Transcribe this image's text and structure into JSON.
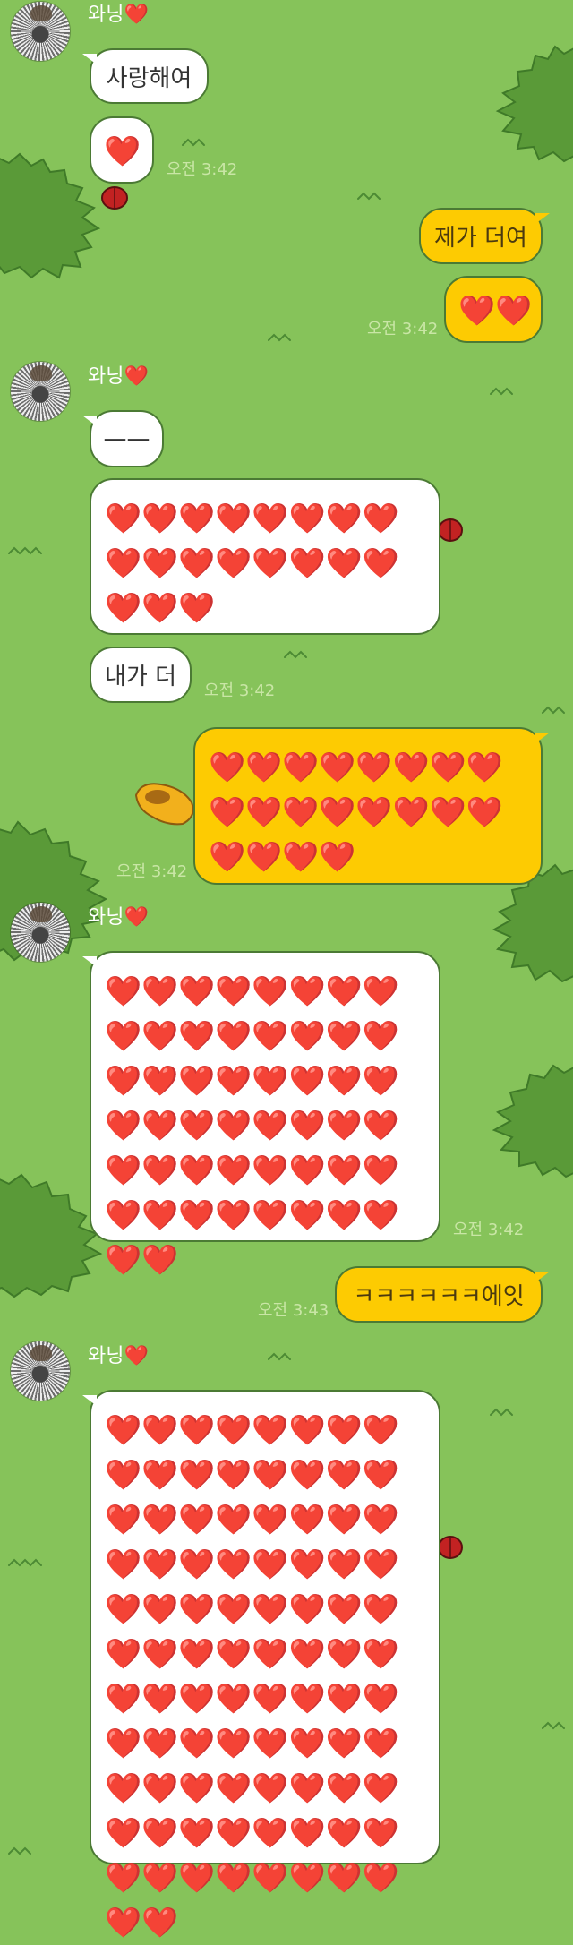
{
  "sender": {
    "name": "와닝❤️"
  },
  "messages": [
    {
      "kind": "text",
      "text": "사랑해여"
    },
    {
      "kind": "hearts",
      "text": "❤️",
      "time": "오전 3:42"
    },
    {
      "kind": "text",
      "text": "제가 더여"
    },
    {
      "kind": "hearts",
      "text": "❤️❤️",
      "time": "오전 3:42"
    },
    {
      "kind": "text",
      "text": "——"
    },
    {
      "kind": "hearts",
      "text": "❤️❤️❤️❤️❤️❤️❤️❤️❤️❤️❤️❤️❤️❤️❤️❤️❤️❤️❤️"
    },
    {
      "kind": "text",
      "text": "내가 더",
      "time": "오전 3:42"
    },
    {
      "kind": "hearts",
      "text": "❤️❤️❤️❤️❤️❤️❤️❤️❤️❤️❤️❤️❤️❤️❤️❤️❤️❤️❤️❤️",
      "time": "오전 3:42"
    },
    {
      "kind": "hearts",
      "text": "❤️❤️❤️❤️❤️❤️❤️❤️❤️❤️❤️❤️❤️❤️❤️❤️❤️❤️❤️❤️❤️❤️❤️❤️❤️❤️❤️❤️❤️❤️❤️❤️❤️❤️❤️❤️❤️❤️❤️❤️❤️❤️❤️❤️❤️❤️❤️❤️❤️❤️",
      "time": "오전 3:42"
    },
    {
      "kind": "text",
      "text": "ㅋㅋㅋㅋㅋㅋ에잇",
      "time": "오전 3:43"
    },
    {
      "kind": "hearts",
      "text": "❤️❤️❤️❤️❤️❤️❤️❤️❤️❤️❤️❤️❤️❤️❤️❤️❤️❤️❤️❤️❤️❤️❤️❤️❤️❤️❤️❤️❤️❤️❤️❤️❤️❤️❤️❤️❤️❤️❤️❤️❤️❤️❤️❤️❤️❤️❤️❤️❤️❤️❤️❤️❤️❤️❤️❤️❤️❤️❤️❤️❤️❤️❤️❤️❤️❤️❤️❤️❤️❤️❤️❤️❤️❤️❤️❤️❤️❤️❤️❤️❤️❤️❤️❤️❤️❤️❤️❤️❤️❤️"
    }
  ],
  "colors": {
    "background": "#86c35a",
    "incoming_bubble": "#ffffff",
    "outgoing_bubble": "#fdcb02",
    "bush": "#5a9a38",
    "bush_outline": "#3f7a28",
    "timestamp": "#c9e6a6"
  }
}
